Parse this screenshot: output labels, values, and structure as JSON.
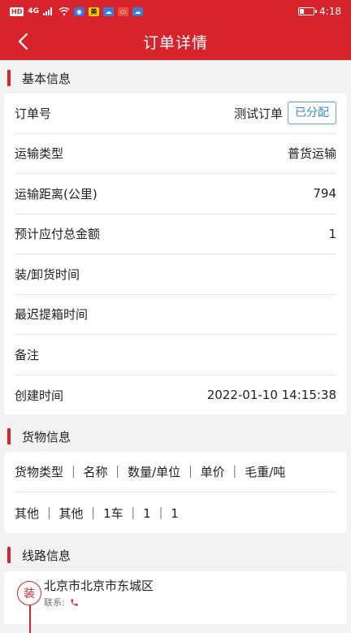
{
  "status_bar": {
    "left_chips": [
      "HD",
      "4G"
    ],
    "badge_mei": "美",
    "time": "4:18"
  },
  "nav": {
    "title": "订单详情"
  },
  "sections": {
    "basic": "基本信息",
    "goods": "货物信息",
    "route": "线路信息"
  },
  "basic_info": [
    {
      "label": "订单号",
      "value": "测试订单",
      "tag": "已分配"
    },
    {
      "label": "运输类型",
      "value": "普货运输"
    },
    {
      "label": "运输距离(公里)",
      "value": "794"
    },
    {
      "label": "预计应付总金额",
      "value": "1"
    },
    {
      "label": "装/卸货时间",
      "value": ""
    },
    {
      "label": "最迟提箱时间",
      "value": ""
    },
    {
      "label": "备注",
      "value": ""
    },
    {
      "label": "创建时间",
      "value": "2022-01-10 14:15:38"
    }
  ],
  "goods_info": {
    "header": "货物类型 ｜ 名称 ｜ 数量/单位 ｜ 单价 ｜ 毛重/吨",
    "row": "其他 ｜ 其他 ｜ 1车 ｜ 1 ｜ 1"
  },
  "route_info": {
    "stamp": "装",
    "address": "北京市北京市东城区",
    "contact_label": "联系:"
  },
  "colors": {
    "brand_red": "#d7232b",
    "tag_blue": "#3f8ec4",
    "page_bg": "#f2f2f2"
  }
}
